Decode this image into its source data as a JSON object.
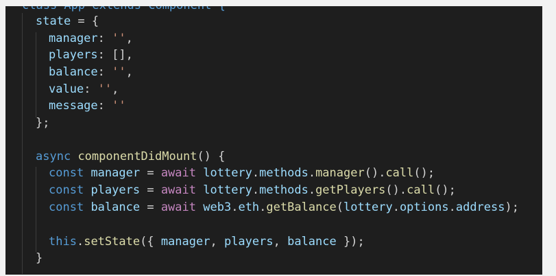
{
  "lines": [
    {
      "tokens": [
        {
          "t": "class App extends Component {",
          "c": "kw"
        }
      ]
    },
    {
      "tokens": [
        {
          "t": "state",
          "c": "var"
        },
        {
          "t": " = {",
          "c": "plain"
        }
      ]
    },
    {
      "tokens": [
        {
          "t": "manager",
          "c": "var"
        },
        {
          "t": ": ",
          "c": "plain"
        },
        {
          "t": "''",
          "c": "str"
        },
        {
          "t": ",",
          "c": "plain"
        }
      ]
    },
    {
      "tokens": [
        {
          "t": "players",
          "c": "var"
        },
        {
          "t": ": [],",
          "c": "plain"
        }
      ]
    },
    {
      "tokens": [
        {
          "t": "balance",
          "c": "var"
        },
        {
          "t": ": ",
          "c": "plain"
        },
        {
          "t": "''",
          "c": "str"
        },
        {
          "t": ",",
          "c": "plain"
        }
      ]
    },
    {
      "tokens": [
        {
          "t": "value",
          "c": "var"
        },
        {
          "t": ": ",
          "c": "plain"
        },
        {
          "t": "''",
          "c": "str"
        },
        {
          "t": ",",
          "c": "plain"
        }
      ]
    },
    {
      "tokens": [
        {
          "t": "message",
          "c": "var"
        },
        {
          "t": ": ",
          "c": "plain"
        },
        {
          "t": "''",
          "c": "str"
        }
      ]
    },
    {
      "tokens": [
        {
          "t": "};",
          "c": "plain"
        }
      ]
    },
    {
      "tokens": []
    },
    {
      "tokens": [
        {
          "t": "async",
          "c": "kw"
        },
        {
          "t": " ",
          "c": "plain"
        },
        {
          "t": "componentDidMount",
          "c": "fn"
        },
        {
          "t": "() {",
          "c": "plain"
        }
      ]
    },
    {
      "tokens": [
        {
          "t": "const",
          "c": "kw"
        },
        {
          "t": " ",
          "c": "plain"
        },
        {
          "t": "manager",
          "c": "var"
        },
        {
          "t": " = ",
          "c": "plain"
        },
        {
          "t": "await",
          "c": "ctrl"
        },
        {
          "t": " ",
          "c": "plain"
        },
        {
          "t": "lottery",
          "c": "var"
        },
        {
          "t": ".",
          "c": "plain"
        },
        {
          "t": "methods",
          "c": "var"
        },
        {
          "t": ".",
          "c": "plain"
        },
        {
          "t": "manager",
          "c": "fn"
        },
        {
          "t": "().",
          "c": "plain"
        },
        {
          "t": "call",
          "c": "fn"
        },
        {
          "t": "();",
          "c": "plain"
        }
      ]
    },
    {
      "tokens": [
        {
          "t": "const",
          "c": "kw"
        },
        {
          "t": " ",
          "c": "plain"
        },
        {
          "t": "players",
          "c": "var"
        },
        {
          "t": " = ",
          "c": "plain"
        },
        {
          "t": "await",
          "c": "ctrl"
        },
        {
          "t": " ",
          "c": "plain"
        },
        {
          "t": "lottery",
          "c": "var"
        },
        {
          "t": ".",
          "c": "plain"
        },
        {
          "t": "methods",
          "c": "var"
        },
        {
          "t": ".",
          "c": "plain"
        },
        {
          "t": "getPlayers",
          "c": "fn"
        },
        {
          "t": "().",
          "c": "plain"
        },
        {
          "t": "call",
          "c": "fn"
        },
        {
          "t": "();",
          "c": "plain"
        }
      ]
    },
    {
      "tokens": [
        {
          "t": "const",
          "c": "kw"
        },
        {
          "t": " ",
          "c": "plain"
        },
        {
          "t": "balance",
          "c": "var"
        },
        {
          "t": " = ",
          "c": "plain"
        },
        {
          "t": "await",
          "c": "ctrl"
        },
        {
          "t": " ",
          "c": "plain"
        },
        {
          "t": "web3",
          "c": "var"
        },
        {
          "t": ".",
          "c": "plain"
        },
        {
          "t": "eth",
          "c": "var"
        },
        {
          "t": ".",
          "c": "plain"
        },
        {
          "t": "getBalance",
          "c": "fn"
        },
        {
          "t": "(",
          "c": "plain"
        },
        {
          "t": "lottery",
          "c": "var"
        },
        {
          "t": ".",
          "c": "plain"
        },
        {
          "t": "options",
          "c": "var"
        },
        {
          "t": ".",
          "c": "plain"
        },
        {
          "t": "address",
          "c": "var"
        },
        {
          "t": ");",
          "c": "plain"
        }
      ]
    },
    {
      "tokens": []
    },
    {
      "tokens": [
        {
          "t": "this",
          "c": "kw"
        },
        {
          "t": ".",
          "c": "plain"
        },
        {
          "t": "setState",
          "c": "fn"
        },
        {
          "t": "({ ",
          "c": "plain"
        },
        {
          "t": "manager",
          "c": "var"
        },
        {
          "t": ", ",
          "c": "plain"
        },
        {
          "t": "players",
          "c": "var"
        },
        {
          "t": ", ",
          "c": "plain"
        },
        {
          "t": "balance",
          "c": "var"
        },
        {
          "t": " });",
          "c": "plain"
        }
      ]
    },
    {
      "tokens": [
        {
          "t": "}",
          "c": "plain"
        }
      ]
    }
  ]
}
